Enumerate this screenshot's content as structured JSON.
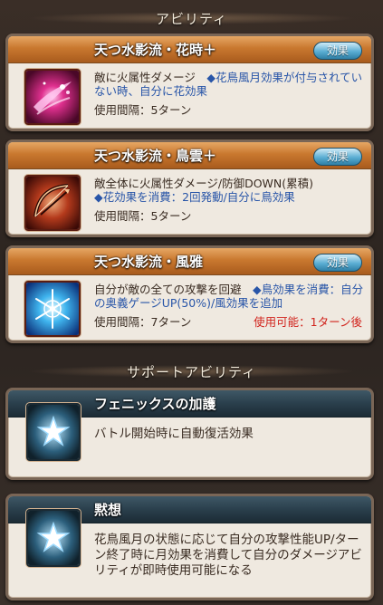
{
  "sections": {
    "abilities_header": "アビリティ",
    "support_header": "サポートアビリティ"
  },
  "abilities": [
    {
      "title": "天つ水影流・花時＋",
      "effect_button": "効果",
      "desc_plain": "敵に火属性ダメージ",
      "desc_blue": "◆花鳥風月効果が付与されていない時、自分に花効果",
      "interval": "使用間隔：5ターン",
      "usable": "",
      "icon": "flower-petal-icon"
    },
    {
      "title": "天つ水影流・鳥雲＋",
      "effect_button": "効果",
      "desc_plain": "敵全体に火属性ダメージ/防御DOWN(累積)",
      "desc_blue": "◆花効果を消費：2回発動/自分に鳥効果",
      "interval": "使用間隔：5ターン",
      "usable": "",
      "icon": "bow-arrow-icon"
    },
    {
      "title": "天つ水影流・風雅",
      "effect_button": "効果",
      "desc_plain": "自分が敵の全ての攻撃を回避",
      "desc_blue": "◆鳥効果を消費：自分の奥義ゲージUP(50%)/風効果を追加",
      "interval": "使用間隔：7ターン",
      "usable": "使用可能：1ターン後",
      "icon": "snowflake-icon"
    }
  ],
  "support": [
    {
      "title": "フェニックスの加護",
      "desc": "バトル開始時に自動復活効果",
      "icon": "star-icon"
    },
    {
      "title": "黙想",
      "desc": "花鳥風月の状態に応じて自分の攻撃性能UP/ターン終了時に月効果を消費して自分のダメージアビリティが即時使用可能になる",
      "icon": "star-icon"
    }
  ],
  "colors": {
    "ability_title_bar": "#c9782f",
    "support_title_bar": "#2a3f4c",
    "blue_text": "#2855a8",
    "usable_text": "#d1231c"
  }
}
